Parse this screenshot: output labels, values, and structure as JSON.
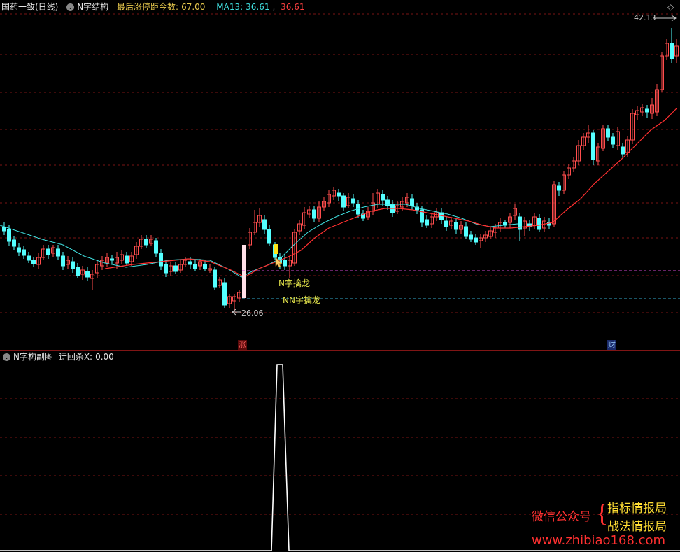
{
  "main_header": {
    "stock_name": "国药一致(日线)",
    "indicator_name": "N字结构",
    "limit_days_label": "最后涨停距今数:",
    "limit_days_value": "67.00",
    "ma_label": "MA13:",
    "ma_value": "36.61",
    "close_value": "36.61"
  },
  "price_labels": {
    "high": "42.13",
    "low": "26.06"
  },
  "signal_labels": {
    "signal1": "N字擒龙",
    "signal2": "NN字擒龙"
  },
  "markers": {
    "zhang": "涨",
    "cai": "财"
  },
  "sub_header": {
    "indicator_name": "N字构副图",
    "param_label": "迂回杀X:",
    "param_value": "0.00"
  },
  "watermark": {
    "left": "微信公众号",
    "brace": "{",
    "line1": "指标情报局",
    "line2": "战法情报局",
    "url": "www.zhibiao168.com"
  },
  "colors": {
    "background": "#000000",
    "up": "#ff4d4d",
    "down": "#54ffff",
    "ma13": "#40e0e0",
    "ma_red": "#ff3030",
    "grid": "#8b1a1a",
    "signal_magenta": "#cc44cc",
    "signal_cyan": "#33aacc",
    "sub_line": "#ffffff"
  },
  "icons": {
    "settings": "circle-chevron-icon",
    "diamond": "diamond-icon"
  }
}
